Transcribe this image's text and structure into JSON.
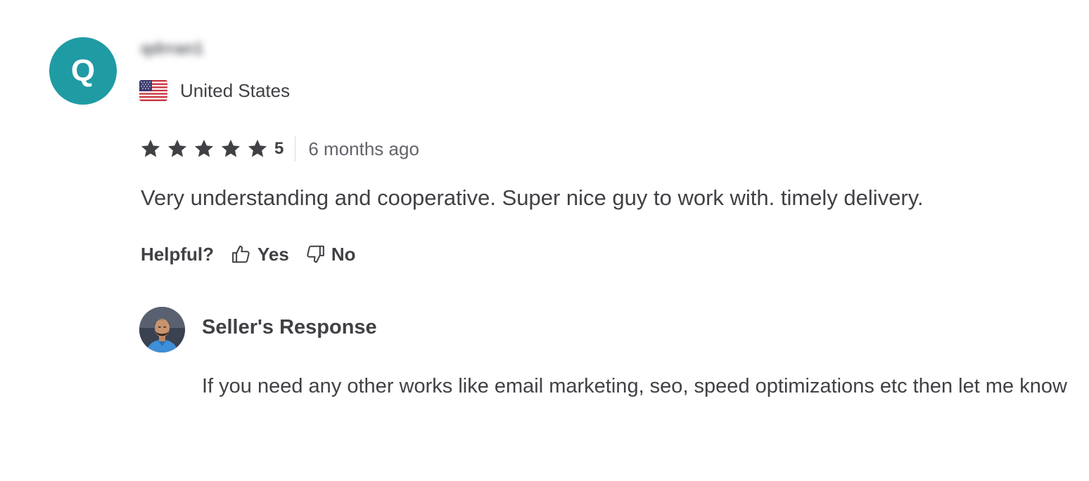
{
  "reviewer": {
    "avatar_letter": "Q",
    "avatar_color": "#1f9ba4",
    "name": "qdrran1",
    "country": "United States",
    "flag_icon": "us-flag-icon"
  },
  "rating": {
    "stars": 5,
    "max_stars": 5,
    "score_label": "5",
    "time_ago": "6 months ago",
    "star_color": "#404145"
  },
  "review": {
    "text": "Very understanding and cooperative. Super nice guy to work with. timely delivery."
  },
  "helpful": {
    "label": "Helpful?",
    "yes_label": "Yes",
    "no_label": "No",
    "yes_icon": "thumbs-up-icon",
    "no_icon": "thumbs-down-icon"
  },
  "seller_response": {
    "title": "Seller's Response",
    "text": "If you need any other works like email marketing, seo, speed optimizations etc then let me know"
  }
}
